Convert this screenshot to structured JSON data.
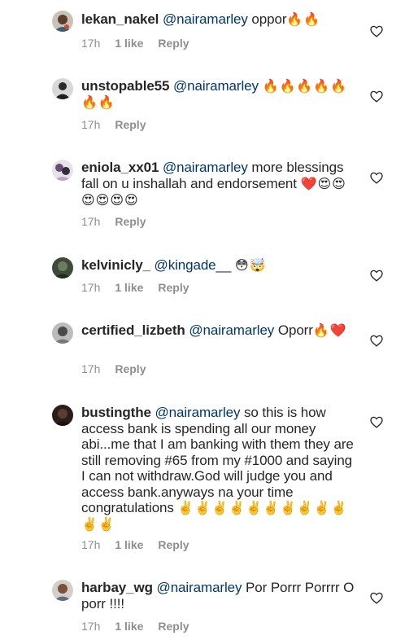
{
  "icons": {
    "avatar": "avatar-icon",
    "like": "heart-outline-icon"
  },
  "colors": {
    "mention": "#00376b",
    "meta": "#8e8e8e",
    "text": "#262626"
  },
  "comments": [
    {
      "username": "lekan_nakel",
      "mention": "@nairamarley",
      "text": " oppor",
      "emoji": "🔥🔥",
      "time": "17h",
      "likes": "1 like",
      "reply": "Reply"
    },
    {
      "username": "unstopable55",
      "mention": "@nairamarley",
      "text": " ",
      "emoji": "🔥🔥🔥🔥🔥🔥🔥",
      "time": "17h",
      "likes": "",
      "reply": "Reply"
    },
    {
      "username": "eniola_xx01",
      "mention": "@nairamarley",
      "text": " more blessings fall on u inshallah and endorsement ",
      "emoji": "❤️😍😍😍😍😍😍",
      "time": "17h",
      "likes": "",
      "reply": "Reply"
    },
    {
      "username": "kelvinicly_",
      "mention": "@kingade__",
      "text": " ",
      "emoji": "😳🤯",
      "time": "17h",
      "likes": "1 like",
      "reply": "Reply"
    },
    {
      "username": "certified_lizbeth",
      "mention": "@nairamarley",
      "text": " Oporr",
      "emoji": "🔥❤️",
      "time": "17h",
      "likes": "",
      "reply": "Reply"
    },
    {
      "username": "bustingthe",
      "mention": "@nairamarley",
      "text": " so this is how access bank is spending all our money abi...me that I am banking with them they are still removing #65 from my #1000 and saying I can not withdraw.God will judge you and access bank.anyways na your time congratulations ",
      "emoji": "✌️✌️✌️✌️✌️✌️✌️✌️✌️✌️✌️✌️",
      "time": "17h",
      "likes": "1 like",
      "reply": "Reply"
    },
    {
      "username": "harbay_wg",
      "mention": "@nairamarley",
      "text": " Por Porrr Porrrr O porr !!!!",
      "emoji": "",
      "time": "17h",
      "likes": "1 like",
      "reply": "Reply"
    }
  ]
}
